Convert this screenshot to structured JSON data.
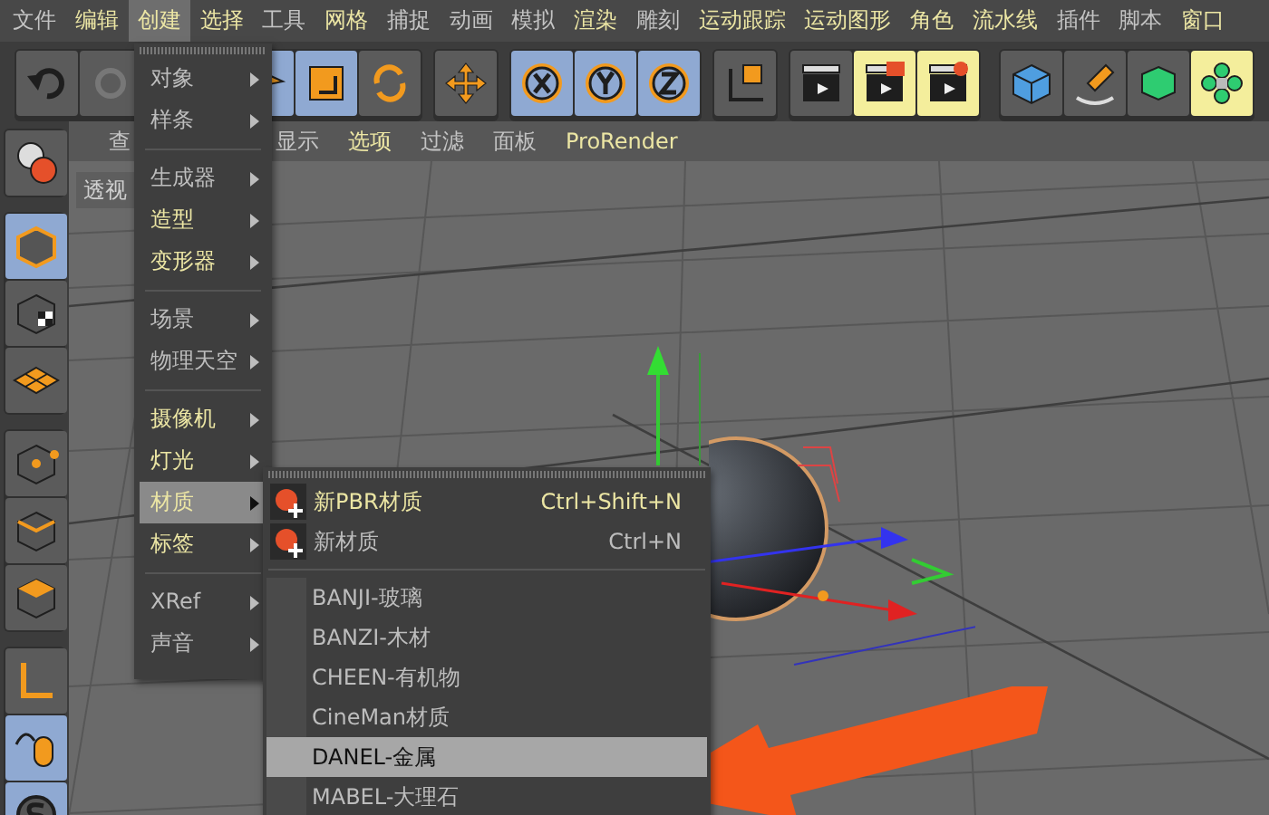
{
  "menubar": [
    {
      "label": "文件",
      "highlighted": false,
      "selected": false
    },
    {
      "label": "编辑",
      "highlighted": true,
      "selected": false
    },
    {
      "label": "创建",
      "highlighted": true,
      "selected": true
    },
    {
      "label": "选择",
      "highlighted": true,
      "selected": false
    },
    {
      "label": "工具",
      "highlighted": false,
      "selected": false
    },
    {
      "label": "网格",
      "highlighted": true,
      "selected": false
    },
    {
      "label": "捕捉",
      "highlighted": false,
      "selected": false
    },
    {
      "label": "动画",
      "highlighted": false,
      "selected": false
    },
    {
      "label": "模拟",
      "highlighted": false,
      "selected": false
    },
    {
      "label": "渲染",
      "highlighted": true,
      "selected": false
    },
    {
      "label": "雕刻",
      "highlighted": false,
      "selected": false
    },
    {
      "label": "运动跟踪",
      "highlighted": true,
      "selected": false
    },
    {
      "label": "运动图形",
      "highlighted": true,
      "selected": false
    },
    {
      "label": "角色",
      "highlighted": true,
      "selected": false
    },
    {
      "label": "流水线",
      "highlighted": true,
      "selected": false
    },
    {
      "label": "插件",
      "highlighted": false,
      "selected": false
    },
    {
      "label": "脚本",
      "highlighted": false,
      "selected": false
    },
    {
      "label": "窗口",
      "highlighted": true,
      "selected": false
    }
  ],
  "toolbar": [
    [
      {
        "kind": "undo",
        "active": false,
        "highlighted": false
      },
      {
        "kind": "redo",
        "active": false,
        "highlighted": false
      }
    ],
    [
      {
        "kind": "select",
        "active": true,
        "highlighted": false
      },
      {
        "kind": "scale",
        "active": true,
        "highlighted": false
      },
      {
        "kind": "rotate",
        "active": false,
        "highlighted": false
      }
    ],
    [
      {
        "kind": "move",
        "active": false,
        "highlighted": false
      }
    ],
    [
      {
        "kind": "x",
        "active": true,
        "highlighted": false
      },
      {
        "kind": "y",
        "active": true,
        "highlighted": false
      },
      {
        "kind": "z",
        "active": true,
        "highlighted": false
      }
    ],
    [
      {
        "kind": "coords",
        "active": false,
        "highlighted": false
      }
    ],
    [
      {
        "kind": "render",
        "active": false,
        "highlighted": false
      },
      {
        "kind": "render-view",
        "active": false,
        "highlighted": true
      },
      {
        "kind": "render-settings",
        "active": false,
        "highlighted": true
      }
    ],
    [
      {
        "kind": "cube",
        "active": false,
        "highlighted": false
      },
      {
        "kind": "pen",
        "active": false,
        "highlighted": false
      },
      {
        "kind": "subdivision",
        "active": false,
        "highlighted": false
      },
      {
        "kind": "cloner",
        "active": false,
        "highlighted": true
      }
    ]
  ],
  "sidebar": [
    [
      {
        "kind": "globe",
        "active": false
      }
    ],
    [
      {
        "kind": "model",
        "active": true
      },
      {
        "kind": "texture",
        "active": false
      },
      {
        "kind": "workplane",
        "active": false
      }
    ],
    [
      {
        "kind": "points",
        "active": false
      },
      {
        "kind": "edges",
        "active": false
      },
      {
        "kind": "polygons",
        "active": false
      }
    ],
    [
      {
        "kind": "axis",
        "active": false
      },
      {
        "kind": "tweak",
        "active": true
      },
      {
        "kind": "snap",
        "active": true
      }
    ]
  ],
  "viewport": {
    "menu": [
      {
        "label": "查",
        "highlighted": false
      },
      {
        "label": "显示",
        "highlighted": false
      },
      {
        "label": "选项",
        "highlighted": true
      },
      {
        "label": "过滤",
        "highlighted": false
      },
      {
        "label": "面板",
        "highlighted": false
      },
      {
        "label": "ProRender",
        "highlighted": true
      }
    ],
    "label": "透视"
  },
  "create_menu": {
    "groups": [
      [
        {
          "label": "对象",
          "highlighted": false,
          "selected": false
        },
        {
          "label": "样条",
          "highlighted": false,
          "selected": false
        }
      ],
      [
        {
          "label": "生成器",
          "highlighted": false,
          "selected": false
        },
        {
          "label": "造型",
          "highlighted": true,
          "selected": false
        },
        {
          "label": "变形器",
          "highlighted": true,
          "selected": false
        }
      ],
      [
        {
          "label": "场景",
          "highlighted": false,
          "selected": false
        },
        {
          "label": "物理天空",
          "highlighted": false,
          "selected": false
        }
      ],
      [
        {
          "label": "摄像机",
          "highlighted": true,
          "selected": false
        },
        {
          "label": "灯光",
          "highlighted": true,
          "selected": false
        },
        {
          "label": "材质",
          "highlighted": true,
          "selected": true
        },
        {
          "label": "标签",
          "highlighted": true,
          "selected": false
        }
      ],
      [
        {
          "label": "XRef",
          "highlighted": false,
          "selected": false
        },
        {
          "label": "声音",
          "highlighted": false,
          "selected": false
        }
      ]
    ]
  },
  "material_menu": {
    "commands": [
      {
        "label": "新PBR材质",
        "shortcut": "Ctrl+Shift+N",
        "highlighted": true
      },
      {
        "label": "新材质",
        "shortcut": "Ctrl+N",
        "highlighted": false
      }
    ],
    "presets": [
      {
        "label": "BANJI-玻璃",
        "selected": false
      },
      {
        "label": "BANZI-木材",
        "selected": false
      },
      {
        "label": "CHEEN-有机物",
        "selected": false
      },
      {
        "label": "CineMan材质",
        "selected": false
      },
      {
        "label": "DANEL-金属",
        "selected": true
      },
      {
        "label": "MABEL-大理石",
        "selected": false
      }
    ]
  }
}
